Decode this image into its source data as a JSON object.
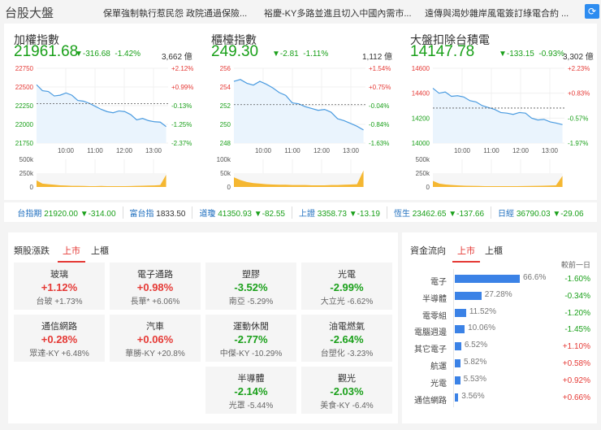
{
  "header": {
    "title": "台股大盤",
    "news": [
      "保單強制執行惹民怨 政院通過保險...",
      "裕慶-KY多路並進且切入中國內需市...",
      "遠傳與渴妙雜岸風電簽訂綠電合約 ..."
    ],
    "refresh_icon": "refresh-icon"
  },
  "panels": [
    {
      "name": "加權指數",
      "value": "21961.68",
      "change": "▼-316.68",
      "pct": "-1.42%",
      "volume": "3,662 億"
    },
    {
      "name": "櫃檯指數",
      "value": "249.30",
      "change": "▼-2.81",
      "pct": "-1.11%",
      "volume": "1,112 億"
    },
    {
      "name": "大盤扣除台積電",
      "value": "14147.78",
      "change": "▼-133.15",
      "pct": "-0.93%",
      "volume": "3,302 億"
    }
  ],
  "chart_data": [
    {
      "type": "line",
      "title": "加權指數",
      "x_ticks": [
        "10:00",
        "11:00",
        "12:00",
        "13:00"
      ],
      "ylim": [
        21750,
        22750
      ],
      "y_ticks": [
        "22750",
        "22500",
        "22250",
        "22000",
        "21750"
      ],
      "right_ticks": [
        "+2.12%",
        "+0.99%",
        "-0.13%",
        "-1.25%",
        "-2.37%"
      ],
      "prev_close": 22278.36,
      "values": [
        22530,
        22450,
        22440,
        22380,
        22390,
        22420,
        22390,
        22320,
        22310,
        22280,
        22240,
        22200,
        22170,
        22155,
        22180,
        22170,
        22130,
        22060,
        22080,
        22050,
        22035,
        22030,
        21970
      ],
      "vol_ticks": [
        "500k",
        "250k",
        "0"
      ],
      "vol_max": 500,
      "volume": [
        120,
        60,
        50,
        40,
        30,
        25,
        20,
        20,
        18,
        15,
        15,
        18,
        15,
        14,
        14,
        15,
        16,
        20,
        22,
        25,
        28,
        35,
        220
      ]
    },
    {
      "type": "line",
      "title": "櫃檯指數",
      "x_ticks": [
        "10:00",
        "11:00",
        "12:00",
        "13:00"
      ],
      "ylim": [
        248,
        256
      ],
      "y_ticks": [
        "256",
        "254",
        "252",
        "250",
        "248"
      ],
      "right_ticks": [
        "+1.54%",
        "+0.75%",
        "-0.04%",
        "-0.84%",
        "-1.63%"
      ],
      "prev_close": 252.11,
      "values": [
        254.6,
        254.8,
        254.4,
        254.2,
        254.6,
        254.3,
        253.9,
        253.4,
        253.1,
        252.3,
        252.2,
        251.9,
        251.7,
        251.5,
        251.6,
        251.3,
        250.6,
        250.4,
        250.1,
        249.8,
        249.4
      ],
      "vol_ticks": [
        "100k",
        "50k",
        "0"
      ],
      "vol_max": 100,
      "volume": [
        35,
        25,
        18,
        14,
        12,
        10,
        9,
        8,
        8,
        7,
        7,
        7,
        6,
        6,
        6,
        7,
        7,
        8,
        9,
        10,
        60
      ]
    },
    {
      "type": "line",
      "title": "大盤扣除台積電",
      "x_ticks": [
        "10:00",
        "11:00",
        "12:00",
        "13:00"
      ],
      "ylim": [
        14000,
        14600
      ],
      "y_ticks": [
        "14600",
        "14400",
        "14200",
        "14000"
      ],
      "right_ticks": [
        "+2.23%",
        "+0.83%",
        "-0.57%",
        "-1.97%"
      ],
      "prev_close": 14280.93,
      "values": [
        14440,
        14400,
        14410,
        14375,
        14380,
        14370,
        14340,
        14330,
        14300,
        14285,
        14270,
        14245,
        14240,
        14230,
        14245,
        14240,
        14200,
        14185,
        14190,
        14170,
        14160,
        14148
      ],
      "vol_ticks": [
        "500k",
        "250k",
        "0"
      ],
      "vol_max": 500,
      "volume": [
        110,
        60,
        45,
        35,
        28,
        22,
        20,
        18,
        15,
        15,
        14,
        14,
        15,
        15,
        16,
        18,
        20,
        22,
        25,
        30,
        200
      ]
    }
  ],
  "ticker": [
    {
      "name": "台指期",
      "value": "21920.00 ▼-314.00"
    },
    {
      "name": "富台指",
      "value": "1833.50",
      "neutral": true
    },
    {
      "name": "道瓊",
      "value": "41350.93 ▼-82.55"
    },
    {
      "name": "上證",
      "value": "3358.73 ▼-13.19"
    },
    {
      "name": "恆生",
      "value": "23462.65 ▼-137.66"
    },
    {
      "name": "日經",
      "value": "36790.03 ▼-29.06"
    }
  ],
  "sectors": {
    "title": "類股漲跌",
    "tabs": [
      "上市",
      "上櫃"
    ],
    "items": [
      {
        "name": "玻璃",
        "pct": "+1.12%",
        "stock": "台玻 +1.73%"
      },
      {
        "name": "電子通路",
        "pct": "+0.98%",
        "stock": "長華* +6.06%"
      },
      {
        "name": "塑膠",
        "pct": "-3.52%",
        "stock": "南亞 -5.29%"
      },
      {
        "name": "光電",
        "pct": "-2.99%",
        "stock": "大立光 -6.62%"
      },
      {
        "name": "通信網路",
        "pct": "+0.28%",
        "stock": "眾達-KY +6.48%"
      },
      {
        "name": "汽車",
        "pct": "+0.06%",
        "stock": "華勝-KY +20.8%"
      },
      {
        "name": "運動休閒",
        "pct": "-2.77%",
        "stock": "中傑-KY -10.29%"
      },
      {
        "name": "油電燃氣",
        "pct": "-2.64%",
        "stock": "台塑化 -3.23%"
      },
      {
        "name": "半導體",
        "pct": "-2.14%",
        "stock": "光罩 -5.44%"
      },
      {
        "name": "觀光",
        "pct": "-2.03%",
        "stock": "美食-KY -6.4%"
      }
    ]
  },
  "flow": {
    "title": "資金流向",
    "tabs": [
      "上市",
      "上櫃"
    ],
    "col_header": "較前一日",
    "items": [
      {
        "name": "電子",
        "share": 66.6,
        "share_label": "66.6%",
        "change": "-1.60%"
      },
      {
        "name": "半導體",
        "share": 27.28,
        "share_label": "27.28%",
        "change": "-0.34%"
      },
      {
        "name": "電零組",
        "share": 11.52,
        "share_label": "11.52%",
        "change": "-1.20%"
      },
      {
        "name": "電腦週邊",
        "share": 10.06,
        "share_label": "10.06%",
        "change": "-1.45%"
      },
      {
        "name": "其它電子",
        "share": 6.52,
        "share_label": "6.52%",
        "change": "+1.10%"
      },
      {
        "name": "航運",
        "share": 5.82,
        "share_label": "5.82%",
        "change": "+0.58%"
      },
      {
        "name": "光電",
        "share": 5.53,
        "share_label": "5.53%",
        "change": "+0.92%"
      },
      {
        "name": "通信網路",
        "share": 3.56,
        "share_label": "3.56%",
        "change": "+0.66%"
      }
    ]
  },
  "colors": {
    "up": "#e53935",
    "down": "#1aa01a",
    "line": "#4a9be0",
    "volume": "#f5b731",
    "bar": "#3b82e6"
  }
}
